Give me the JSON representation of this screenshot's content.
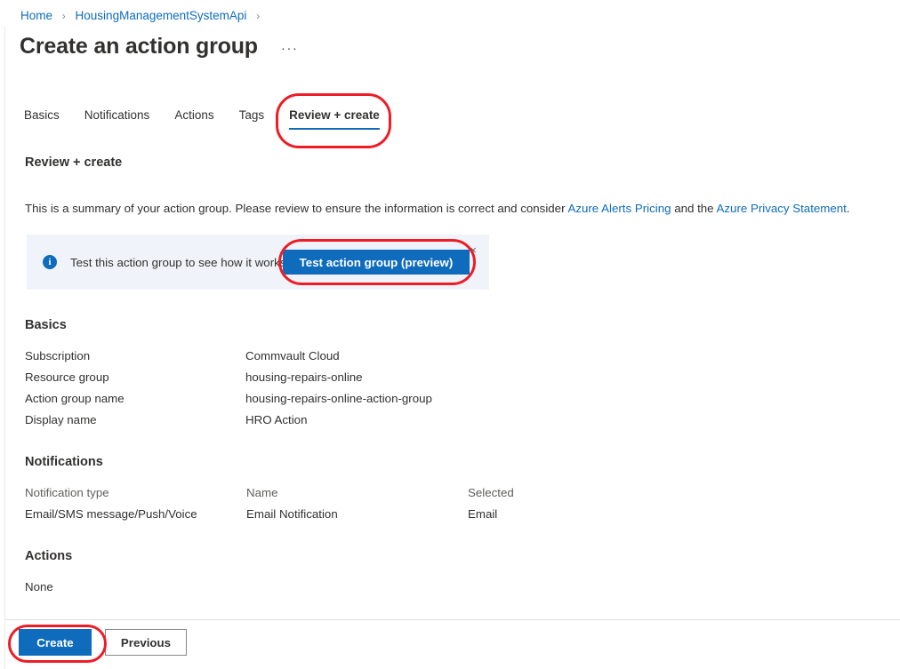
{
  "breadcrumb": {
    "items": [
      {
        "label": "Home"
      },
      {
        "label": "HousingManagementSystemApi"
      }
    ],
    "separator": "›"
  },
  "header": {
    "title": "Create an action group",
    "more_menu": "···"
  },
  "tabs": [
    {
      "label": "Basics",
      "active": false
    },
    {
      "label": "Notifications",
      "active": false
    },
    {
      "label": "Actions",
      "active": false
    },
    {
      "label": "Tags",
      "active": false
    },
    {
      "label": "Review + create",
      "active": true
    }
  ],
  "main": {
    "heading": "Review + create",
    "summary": {
      "part1": "This is a summary of your action group. Please review to ensure the information is correct and consider ",
      "link1": "Azure Alerts Pricing",
      "part2": " and the ",
      "link2": "Azure Privacy Statement",
      "part3": "."
    },
    "info_banner": {
      "icon": "info-icon",
      "text": "Test this action group to see how it works",
      "button_label": "Test action group (preview)",
      "close_label": "×"
    },
    "basics": {
      "heading": "Basics",
      "rows": [
        {
          "key": "Subscription",
          "value": "Commvault Cloud"
        },
        {
          "key": "Resource group",
          "value": "housing-repairs-online"
        },
        {
          "key": "Action group name",
          "value": "housing-repairs-online-action-group"
        },
        {
          "key": "Display name",
          "value": "HRO Action"
        }
      ]
    },
    "notifications": {
      "heading": "Notifications",
      "columns": [
        "Notification type",
        "Name",
        "Selected"
      ],
      "rows": [
        [
          "Email/SMS message/Push/Voice",
          "Email Notification",
          "Email"
        ]
      ]
    },
    "actions": {
      "heading": "Actions",
      "value": "None"
    }
  },
  "footer": {
    "create_label": "Create",
    "previous_label": "Previous"
  },
  "colors": {
    "accent": "#0f6cbd",
    "annotation": "#ee1c25",
    "banner_bg": "#f0f4fa"
  }
}
